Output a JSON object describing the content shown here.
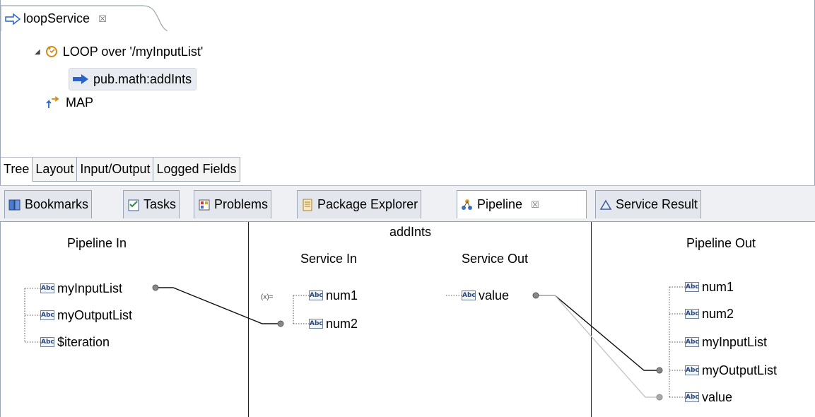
{
  "editor": {
    "tab_title": "loopService",
    "tab_close": "☒",
    "tree": {
      "loop_label": "LOOP over '/myInputList'",
      "step_label": "pub.math:addInts",
      "map_label": "MAP"
    },
    "bottom_tabs": [
      "Tree",
      "Layout",
      "Input/Output",
      "Logged Fields"
    ]
  },
  "views": {
    "tabs": [
      {
        "label": "Bookmarks",
        "icon": "bookmarks-icon"
      },
      {
        "label": "Tasks",
        "icon": "tasks-icon"
      },
      {
        "label": "Problems",
        "icon": "problems-icon"
      },
      {
        "label": "Package Explorer",
        "icon": "package-explorer-icon"
      },
      {
        "label": "Pipeline",
        "icon": "pipeline-icon",
        "close": "☒"
      },
      {
        "label": "Service Result",
        "icon": "service-result-icon"
      }
    ]
  },
  "pipeline": {
    "pipeline_in_title": "Pipeline In",
    "pipeline_in_fields": [
      "myInputList",
      "myOutputList",
      "$iteration"
    ],
    "service_name": "addInts",
    "service_in_title": "Service In",
    "service_in_fields": [
      "num1",
      "num2"
    ],
    "service_out_title": "Service Out",
    "service_out_fields": [
      "value"
    ],
    "pipeline_out_title": "Pipeline Out",
    "pipeline_out_fields": [
      "num1",
      "num2",
      "myInputList",
      "myOutputList",
      "value"
    ],
    "field_type_badge": "Abc",
    "set_value_icon": "(x)="
  },
  "colors": {
    "arrow_blue": "#2a63c9",
    "loop_orange": "#d08a1a",
    "tab_border": "#9aa5b5",
    "wire": "#222222"
  }
}
